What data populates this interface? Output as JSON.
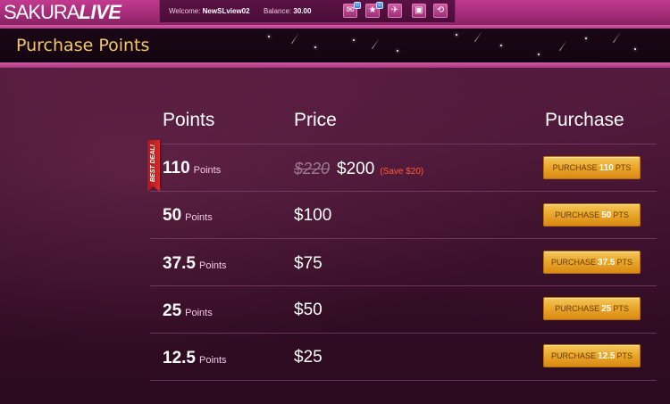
{
  "brand": {
    "logo_light": "SAKURA",
    "logo_bold": "LIVE"
  },
  "topbar": {
    "welcome_label": "Welcome:",
    "username": "NewSLview02",
    "balance_label": "Balance:",
    "balance": "30.00",
    "icons": [
      {
        "name": "messages-icon",
        "glyph": "✉",
        "count": "0"
      },
      {
        "name": "favorites-icon",
        "glyph": "★",
        "count": "0"
      },
      {
        "name": "flights-icon",
        "glyph": "✈",
        "count": ""
      },
      {
        "name": "support-icon",
        "glyph": "▣",
        "count": ""
      },
      {
        "name": "history-icon",
        "glyph": "⟲",
        "count": ""
      }
    ]
  },
  "page": {
    "title": "Purchase Points"
  },
  "table": {
    "headers": {
      "points": "Points",
      "price": "Price",
      "purchase": "Purchase"
    },
    "best_deal_label": "BEST DEAL!",
    "points_unit": "Points",
    "rows": [
      {
        "points": "110",
        "old_price": "$220",
        "price": "$200",
        "save": "(Save $20)",
        "button_prefix": "PURCHASE",
        "button_points": "110",
        "button_suffix": "PTS"
      },
      {
        "points": "50",
        "old_price": "",
        "price": "$100",
        "save": "",
        "button_prefix": "PURCHASE",
        "button_points": "50",
        "button_suffix": "PTS"
      },
      {
        "points": "37.5",
        "old_price": "",
        "price": "$75",
        "save": "",
        "button_prefix": "PURCHASE",
        "button_points": "37.5",
        "button_suffix": "PTS"
      },
      {
        "points": "25",
        "old_price": "",
        "price": "$50",
        "save": "",
        "button_prefix": "PURCHASE",
        "button_points": "25",
        "button_suffix": "PTS"
      },
      {
        "points": "12.5",
        "old_price": "",
        "price": "$25",
        "save": "",
        "button_prefix": "PURCHASE",
        "button_points": "12.5",
        "button_suffix": "PTS"
      }
    ]
  },
  "colors": {
    "brand_pink": "#c23a8f",
    "title_gold": "#f2c86a",
    "button_gold": "#e9a529",
    "save_red": "#ff5a3a",
    "ribbon_red": "#b01818"
  }
}
